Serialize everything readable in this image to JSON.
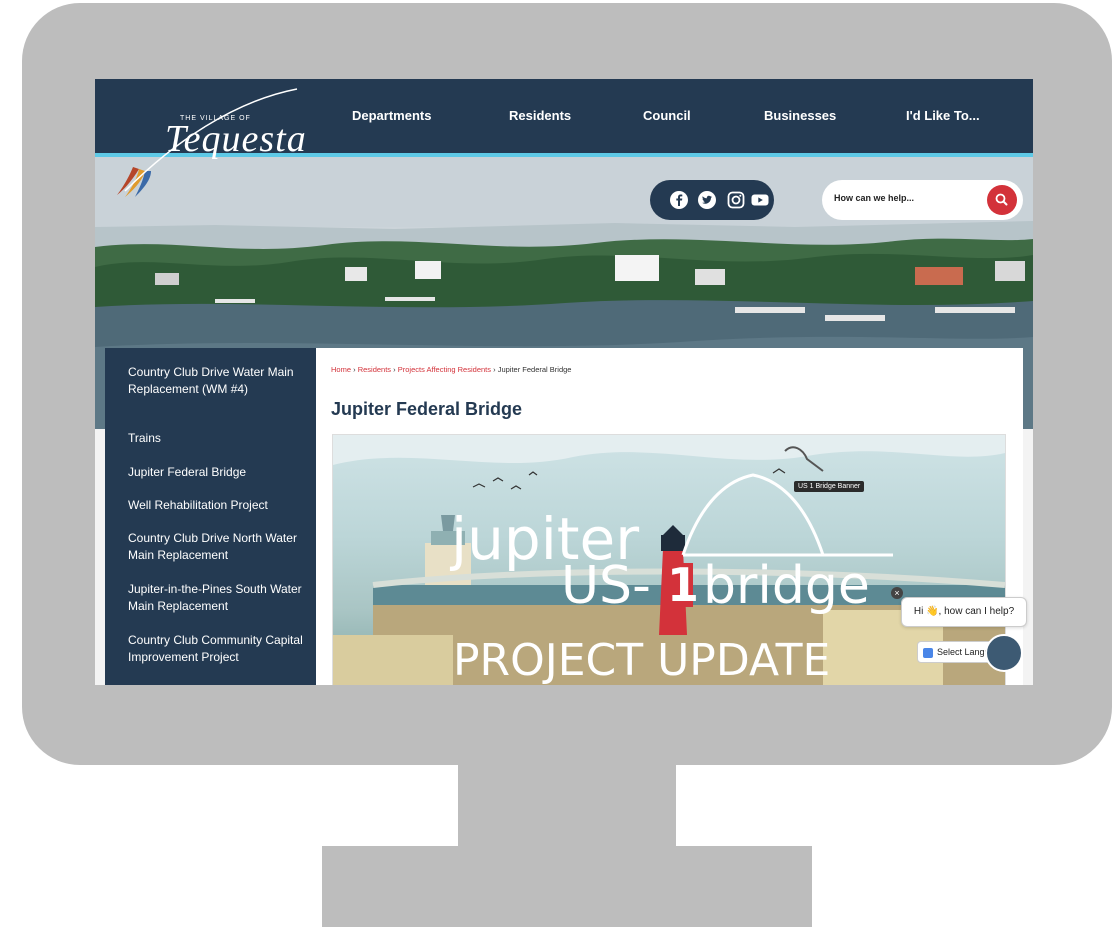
{
  "logo": {
    "small_text": "THE VILLAGE OF",
    "script_text": "Tequesta"
  },
  "nav": {
    "items": [
      {
        "label": "Departments"
      },
      {
        "label": "Residents"
      },
      {
        "label": "Council"
      },
      {
        "label": "Businesses"
      },
      {
        "label": "I'd Like To..."
      }
    ]
  },
  "social": {
    "icons": [
      "facebook-icon",
      "twitter-icon",
      "instagram-icon",
      "youtube-icon"
    ]
  },
  "search": {
    "placeholder": "How can we help..."
  },
  "sidebar": {
    "items": [
      {
        "label": "Country Club Drive Water Main Replacement (WM #4)"
      },
      {
        "label": "Trains"
      },
      {
        "label": "Jupiter Federal Bridge"
      },
      {
        "label": "Well Rehabilitation Project"
      },
      {
        "label": "Country Club Drive North Water Main Replacement"
      },
      {
        "label": "Jupiter-in-the-Pines South Water Main Replacement"
      },
      {
        "label": "Country Club Community Capital Improvement Project"
      }
    ]
  },
  "breadcrumb": {
    "home": "Home",
    "residents": "Residents",
    "projects": "Projects Affecting Residents",
    "current": "Jupiter Federal Bridge",
    "separator": "›"
  },
  "page": {
    "title": "Jupiter Federal Bridge"
  },
  "banner": {
    "tooltip": "US 1 Bridge Banner",
    "word1": "jupiter",
    "word2": "US-",
    "word3": "1",
    "word4": "bridge",
    "subtitle": "PROJECT UPDATE"
  },
  "chat": {
    "greeting": "Hi 👋, how can I help?",
    "close": "×"
  },
  "translate": {
    "label": "Select Language"
  },
  "colors": {
    "navy": "#243a52",
    "accent_red": "#d3323a",
    "accent_cyan": "#5ec9e6",
    "frame_gray": "#bdbdbd"
  }
}
